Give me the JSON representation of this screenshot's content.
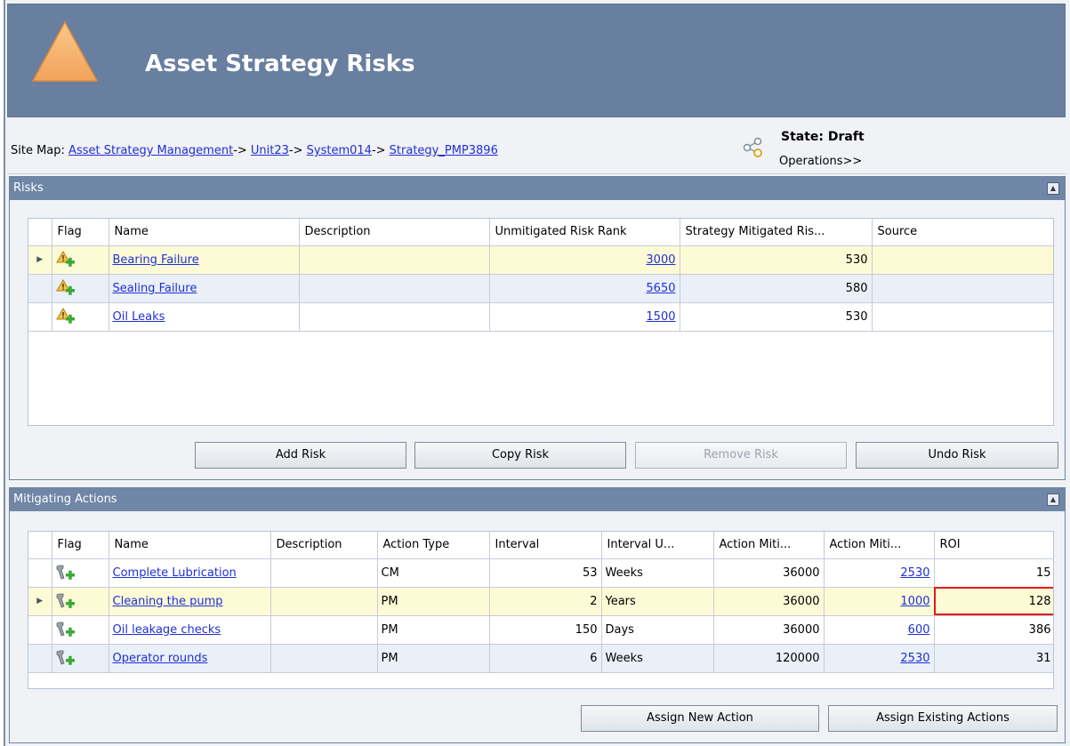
{
  "header": {
    "title": "Asset Strategy Risks",
    "logo_icon": "warning-triangle-icon",
    "bg_color": "#687f9f"
  },
  "sitemap": {
    "label": "Site Map: ",
    "links": [
      "Asset Strategy Management",
      "Unit23",
      "System014",
      "Strategy_PMP3896"
    ],
    "separator": "-> "
  },
  "state": {
    "title": "State: Draft",
    "operations": "Operations>>"
  },
  "risks_panel": {
    "title": "Risks",
    "columns": [
      "Flag",
      "Name",
      "Description",
      "Unmitigated Risk Rank",
      "Strategy Mitigated Ris...",
      "Source"
    ],
    "rows": [
      {
        "name": "Bearing Failure",
        "description": "",
        "unmitigated": "3000",
        "mitigated": "530",
        "source": "",
        "current": true
      },
      {
        "name": "Sealing Failure",
        "description": "",
        "unmitigated": "5650",
        "mitigated": "580",
        "source": ""
      },
      {
        "name": "Oil Leaks",
        "description": "",
        "unmitigated": "1500",
        "mitigated": "530",
        "source": ""
      }
    ],
    "buttons": {
      "add": "Add Risk",
      "copy": "Copy Risk",
      "remove": "Remove Risk",
      "undo": "Undo Risk"
    }
  },
  "actions_panel": {
    "title": "Mitigating Actions",
    "columns": [
      "Flag",
      "Name",
      "Description",
      "Action Type",
      "Interval",
      "Interval U...",
      "Action Miti...",
      "Action Miti...",
      "ROI"
    ],
    "rows": [
      {
        "name": "Complete Lubrication",
        "description": "",
        "type": "CM",
        "interval": "53",
        "unit": "Weeks",
        "miti1": "36000",
        "miti2": "2530",
        "roi": "15"
      },
      {
        "name": "Cleaning the pump",
        "description": "",
        "type": "PM",
        "interval": "2",
        "unit": "Years",
        "miti1": "36000",
        "miti2": "1000",
        "roi": "128",
        "current": true
      },
      {
        "name": "Oil leakage checks",
        "description": "",
        "type": "PM",
        "interval": "150",
        "unit": "Days",
        "miti1": "36000",
        "miti2": "600",
        "roi": "386"
      },
      {
        "name": "Operator rounds",
        "description": "",
        "type": "PM",
        "interval": "6",
        "unit": "Weeks",
        "miti1": "120000",
        "miti2": "2530",
        "roi": "31"
      }
    ],
    "buttons": {
      "assign_new": "Assign New Action",
      "assign_existing": "Assign Existing Actions"
    }
  },
  "colors": {
    "link": "#1e2fd6",
    "selected_row": "#fdfbd6",
    "alt_row": "#eaf0f8",
    "highlight_border": "#e01b1b"
  }
}
